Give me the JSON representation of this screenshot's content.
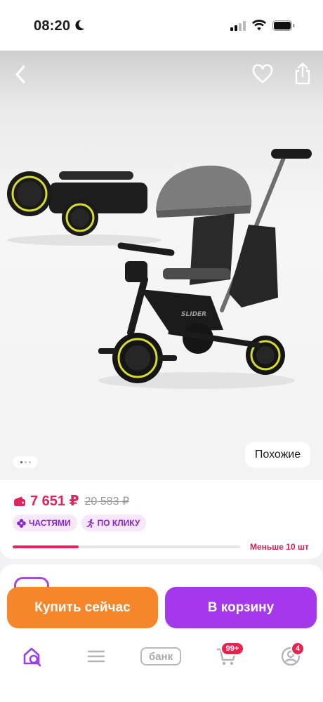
{
  "status_bar": {
    "time": "08:20"
  },
  "gallery": {
    "photo_alt": "",
    "dot_count": 3,
    "active_dot": 1,
    "similar_label": "Похожие"
  },
  "price_card": {
    "price": "7 651 ₽",
    "old_price": "20 583 ₽",
    "badges": [
      {
        "label": "ЧАСТЯМИ",
        "icon": "flower-icon"
      },
      {
        "label": "ПО КЛИКУ",
        "icon": "running-man-icon"
      }
    ],
    "stock_level": 0.29,
    "stock_text": "Меньше 10 шт"
  },
  "actions": {
    "buy_now": "Купить сейчас",
    "to_cart": "В корзину"
  },
  "tabbar": {
    "bank_label": "банк",
    "cart_badge": "99+",
    "profile_badge": "4"
  },
  "colors": {
    "accent_purple": "#a638ec",
    "accent_orange": "#f5872a",
    "price_red": "#e0245e"
  }
}
